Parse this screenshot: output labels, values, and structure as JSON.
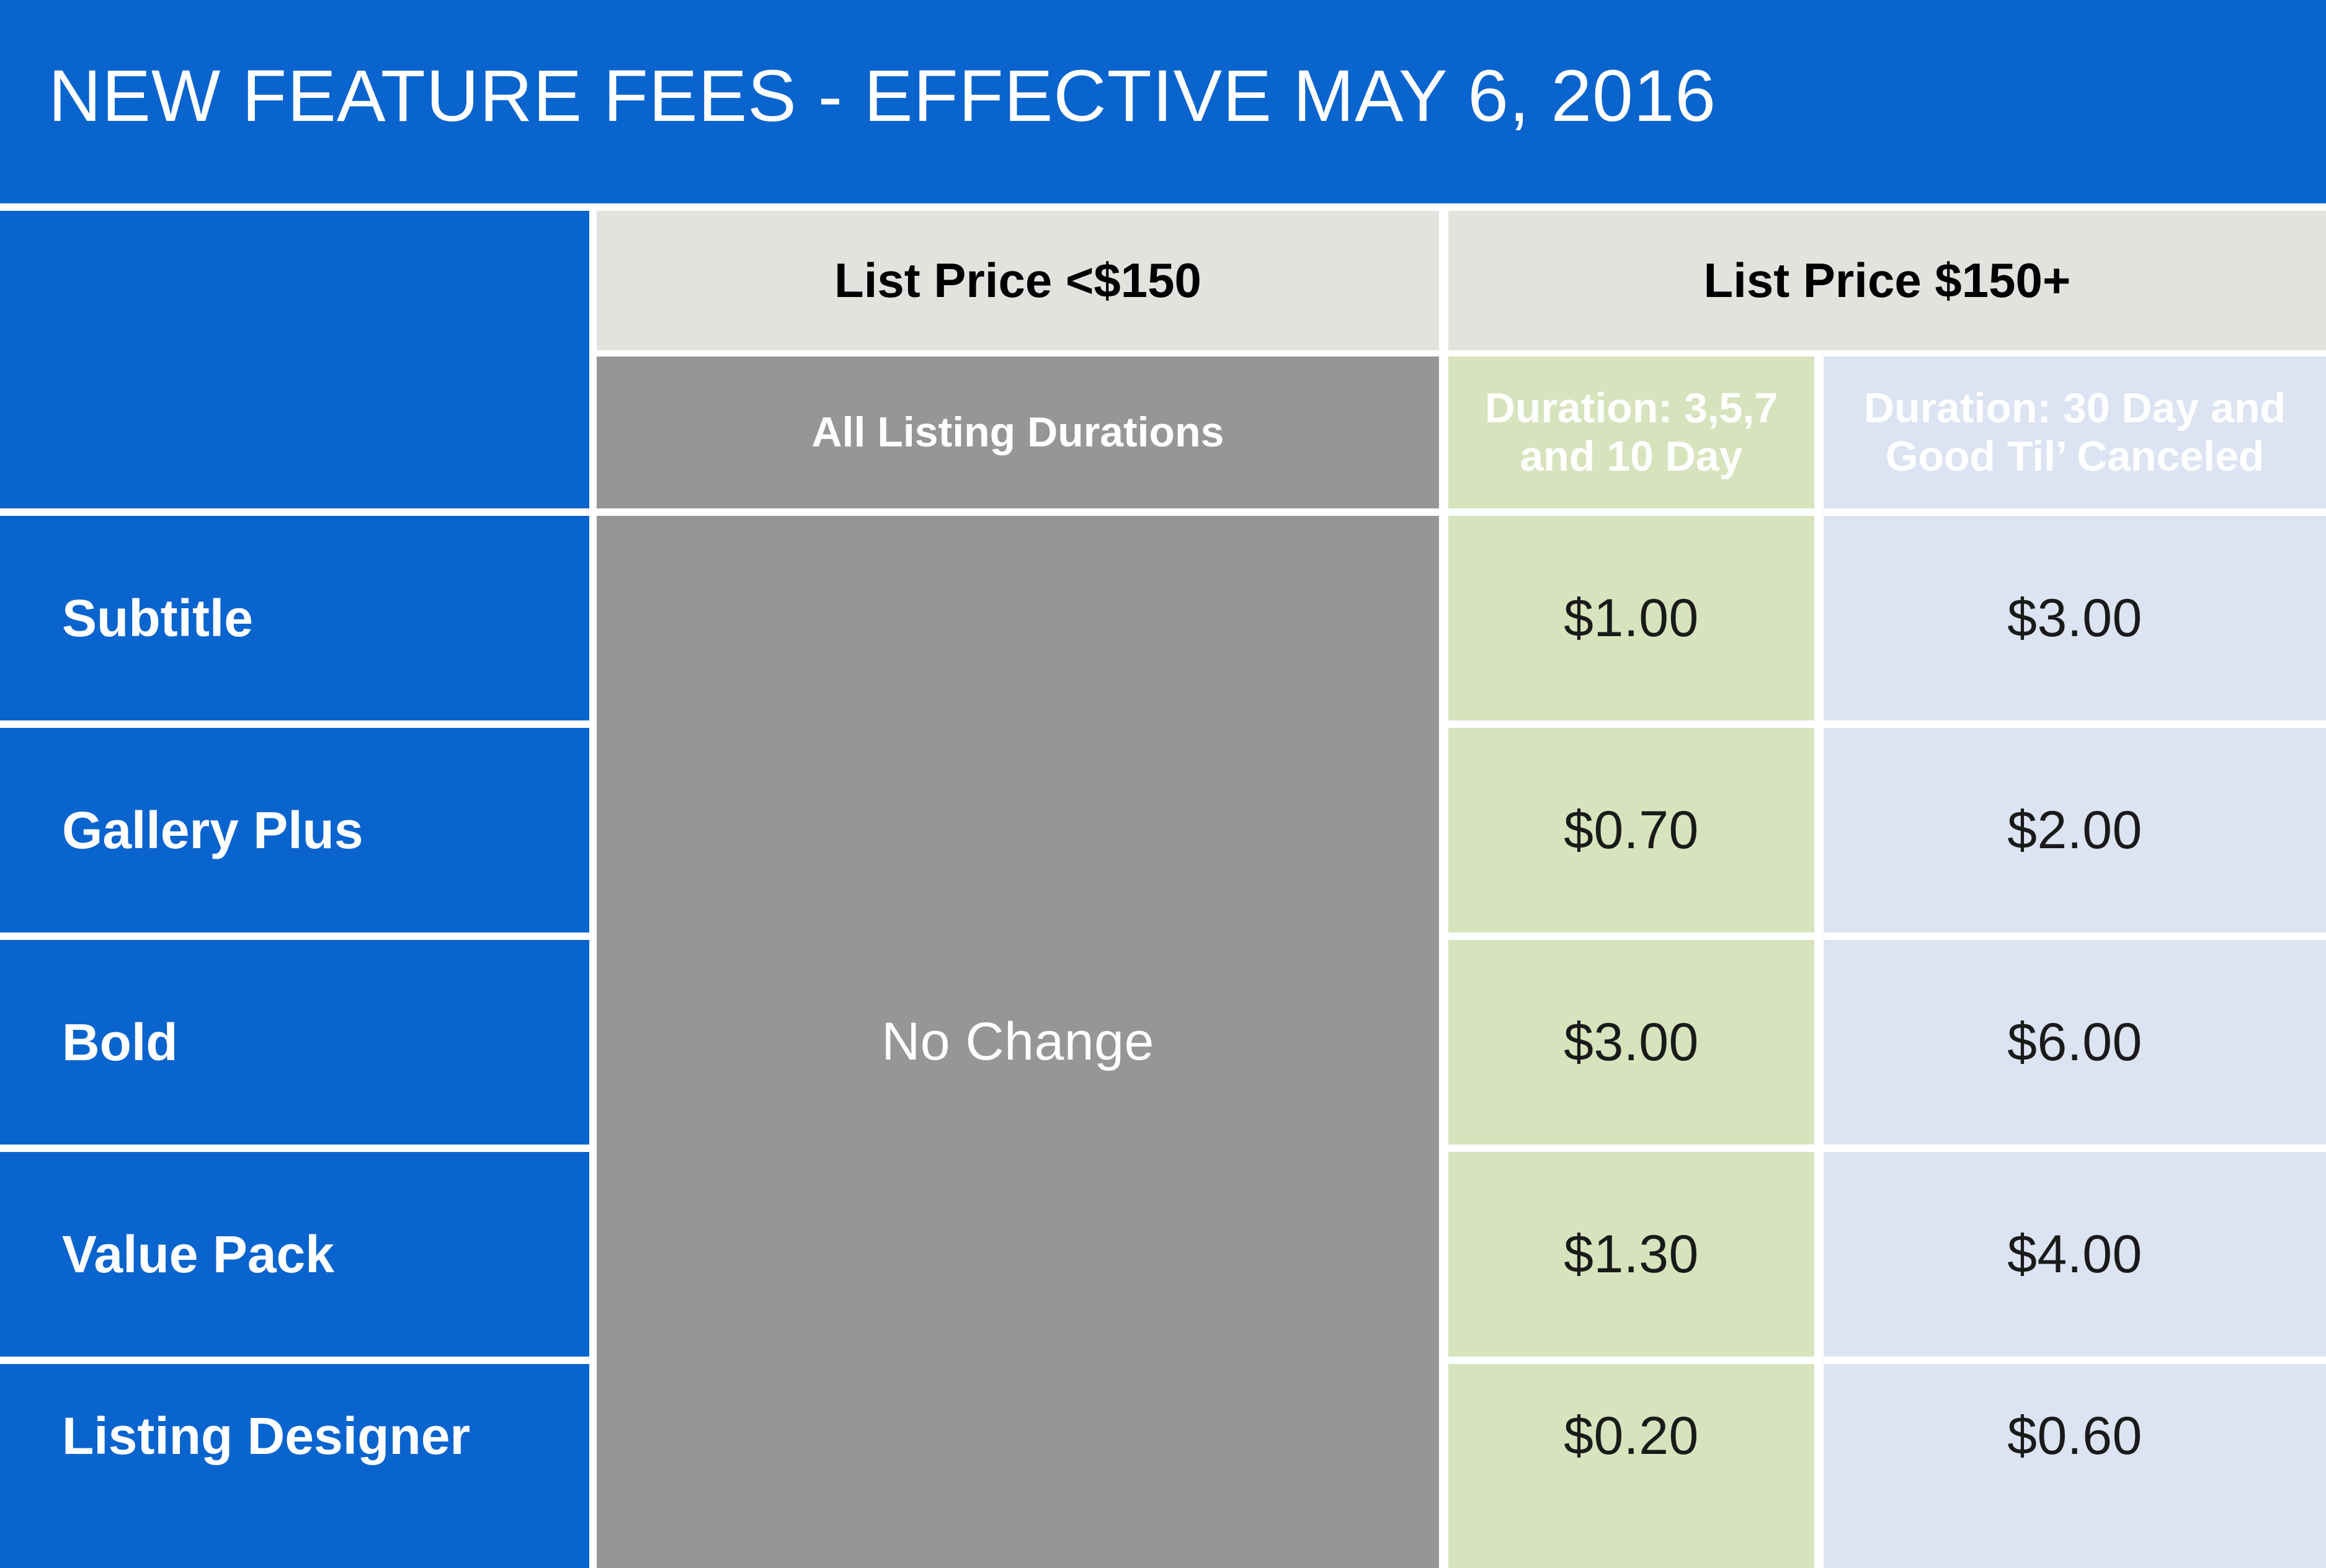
{
  "header": {
    "title": "NEW FEATURE FEES - EFFECTIVE MAY 6, 2016",
    "background_color": "#0a64ce",
    "text_color": "#ffffff"
  },
  "table": {
    "group_headers": [
      {
        "label": "List Price <$150",
        "background_color": "#e2e2de"
      },
      {
        "label": "List Price $150+",
        "background_color": "#e2e2de"
      }
    ],
    "sub_headers": [
      {
        "label": "All Listing Durations",
        "background_color": "#969696",
        "text_color": "#ffffff"
      },
      {
        "label": "Duration: 3,5,7 and 10 Day",
        "background_color": "#d7e3bd",
        "text_color": "#ffffff"
      },
      {
        "label": "Duration: 30 Day and Good Til’ Canceled",
        "background_color": "#dce3f2",
        "text_color": "#ffffff"
      }
    ],
    "merged_cell": {
      "label": "No Change",
      "background_color": "#969696",
      "text_color": "#ffffff"
    },
    "row_label_column": {
      "background_color": "#0a64ce",
      "text_color": "#ffffff"
    },
    "rows": [
      {
        "feature": "Subtitle",
        "all_durations": "No Change",
        "duration_short": "$1.00",
        "duration_long": "$3.00"
      },
      {
        "feature": "Gallery Plus",
        "all_durations": "No Change",
        "duration_short": "$0.70",
        "duration_long": "$2.00"
      },
      {
        "feature": "Bold",
        "all_durations": "No Change",
        "duration_short": "$3.00",
        "duration_long": "$6.00"
      },
      {
        "feature": "Value Pack",
        "all_durations": "No Change",
        "duration_short": "$1.30",
        "duration_long": "$4.00"
      },
      {
        "feature": "Listing Designer",
        "all_durations": "No Change",
        "duration_short": "$0.20",
        "duration_long": "$0.60"
      }
    ]
  },
  "colors": {
    "brand_blue": "#0a64ce",
    "header_gray": "#e2e2de",
    "mid_gray": "#969696",
    "green": "#d7e3bd",
    "light_blue": "#dce3f2",
    "page_background": "#ffffff"
  }
}
